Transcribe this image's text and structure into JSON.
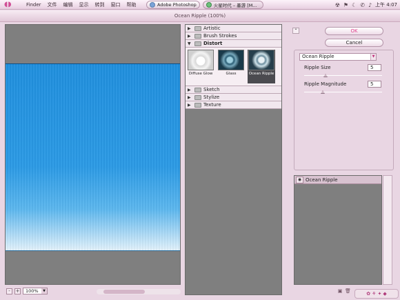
{
  "menubar": {
    "items": [
      "Finder",
      "文件",
      "编辑",
      "显示",
      "转到",
      "窗口",
      "帮助"
    ],
    "tasks": [
      {
        "label": "Adobe Photoshop",
        "active": true
      },
      {
        "label": "火星时代 – 墨游 [M...",
        "active": false
      }
    ],
    "clock": "上午 4:07"
  },
  "window": {
    "title": "Ocean Ripple (100%)"
  },
  "preview": {
    "zoom": "100%",
    "zoom_out": "-",
    "zoom_in": "+"
  },
  "filter_gallery": {
    "categories": [
      {
        "name": "Artistic",
        "expanded": false
      },
      {
        "name": "Brush Strokes",
        "expanded": false
      },
      {
        "name": "Distort",
        "expanded": true
      },
      {
        "name": "Sketch",
        "expanded": false
      },
      {
        "name": "Stylize",
        "expanded": false
      },
      {
        "name": "Texture",
        "expanded": false
      }
    ],
    "distort_filters": [
      {
        "label": "Diffuse Glow",
        "selected": false
      },
      {
        "label": "Glass",
        "selected": false
      },
      {
        "label": "Ocean Ripple",
        "selected": true
      }
    ]
  },
  "options": {
    "ok": "OK",
    "cancel": "Cancel",
    "selected_filter": "Ocean Ripple",
    "ripple_size_label": "Ripple Size",
    "ripple_size_value": "5",
    "ripple_magnitude_label": "Ripple Magnitude",
    "ripple_magnitude_value": "5"
  },
  "layers": {
    "effect_layer": "Ocean Ripple"
  },
  "colors": {
    "accent": "#e1428e",
    "water_top": "#1f8fde",
    "panel_gray": "#7f7f7f"
  }
}
